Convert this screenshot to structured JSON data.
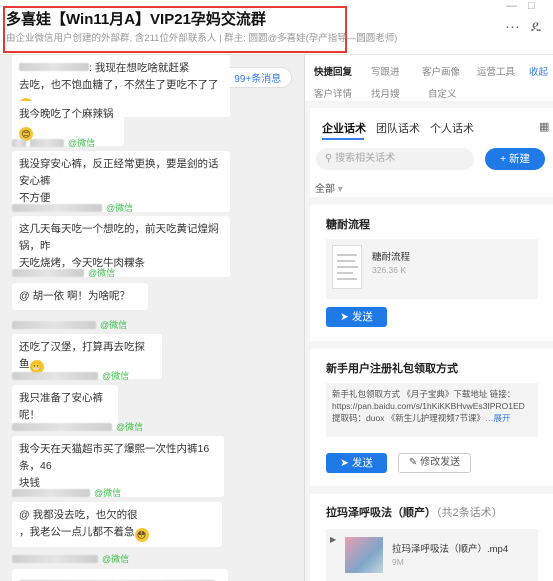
{
  "window": {
    "minimize": "—",
    "maximize": "□",
    "more": "···",
    "contact_icon": "ዴ"
  },
  "header": {
    "title": "多喜娃【Win11月A】VIP21孕妈交流群",
    "subtitle": "由企业微信用户创建的外部群, 含211位外部联系人 | 群主: 圆圆@多喜娃(孕产指导—圆圆老师)"
  },
  "chat": {
    "new_messages": "99+条消息",
    "messages": [
      {
        "sender_suffix": "",
        "text_lines": [
          ": 我现在想吃啥就赶紧",
          "去吃，也不饱血糖了，不然生了更吃不了了"
        ],
        "emoji": "😭"
      },
      {
        "sender_suffix": "",
        "text_lines": [
          "- - - - - - - - - - - - - -",
          "我今晚吃了个麻辣锅"
        ],
        "emoji": "😊"
      },
      {
        "sender_suffix": "@微信",
        "text_lines": [
          "我没穿安心裤，反正经常更换，要是刽的话安心裤",
          "不方便"
        ]
      },
      {
        "sender_suffix": "@微信",
        "text_lines": [
          "这几天每天吃一个想吃的，前天吃黄记煌焖锅，昨",
          "天吃烧烤，今天吃牛肉粿条"
        ]
      },
      {
        "sender_suffix": "@微信",
        "text_lines": [
          "@     胡一依     啊！为啥呢？"
        ]
      },
      {
        "sender_suffix": "@微信",
        "text_lines": [
          "还吃了汉堡，打算再去吃探鱼"
        ],
        "emoji": "😬"
      },
      {
        "sender_suffix": "@微信",
        "text_lines": [
          "我只准备了安心裤呢！"
        ]
      },
      {
        "sender_suffix": "@微信",
        "text_lines": [
          "我今天在天猫超市买了爆熙一次性内裤16条，46",
          "块钱"
        ]
      },
      {
        "sender_suffix": "@微信",
        "text_lines": [
          "@                      我都没去吃，也欠的很",
          "，我老公一点儿都不着急"
        ],
        "emoji": "😳"
      },
      {
        "sender_suffix": "@微信",
        "text_lines": []
      }
    ]
  },
  "right_panel": {
    "nav": [
      "快捷回复",
      "写跟进",
      "客户画像",
      "运营工具",
      "收起",
      "客户详情",
      "找月嫂",
      "自定义"
    ],
    "tabs": [
      "企业话术",
      "团队话术",
      "个人话术"
    ],
    "search_placeholder": "搜索相关话术",
    "new_button": "+ 新建",
    "filter": "全部",
    "sections": [
      {
        "title": "糖耐流程",
        "file_name": "糖耐流程",
        "file_size": "326.36 K",
        "send_label": "发送"
      },
      {
        "title": "新手用户注册礼包领取方式",
        "text_lines": [
          "新手礼包领取方式 《月子宝典》下载地址 链接：",
          "https://pan.baidu.com/s/1hKiKKBHvwEs3IPRO1ED",
          "提取码：duox 《新生儿护理视频7节课》"
        ],
        "more": "…展开",
        "send_label": "发送",
        "edit_send_label": "修改发送"
      },
      {
        "title": "拉玛泽呼吸法（顺产）",
        "count": "（共2条话术）",
        "file_name": "拉玛泽呼吸法（顺产）.mp4",
        "file_size": "9M"
      }
    ]
  },
  "colors": {
    "accent": "#1f7ae8",
    "highlight_box": "#e53935",
    "wechat": "#3dbf4a"
  }
}
